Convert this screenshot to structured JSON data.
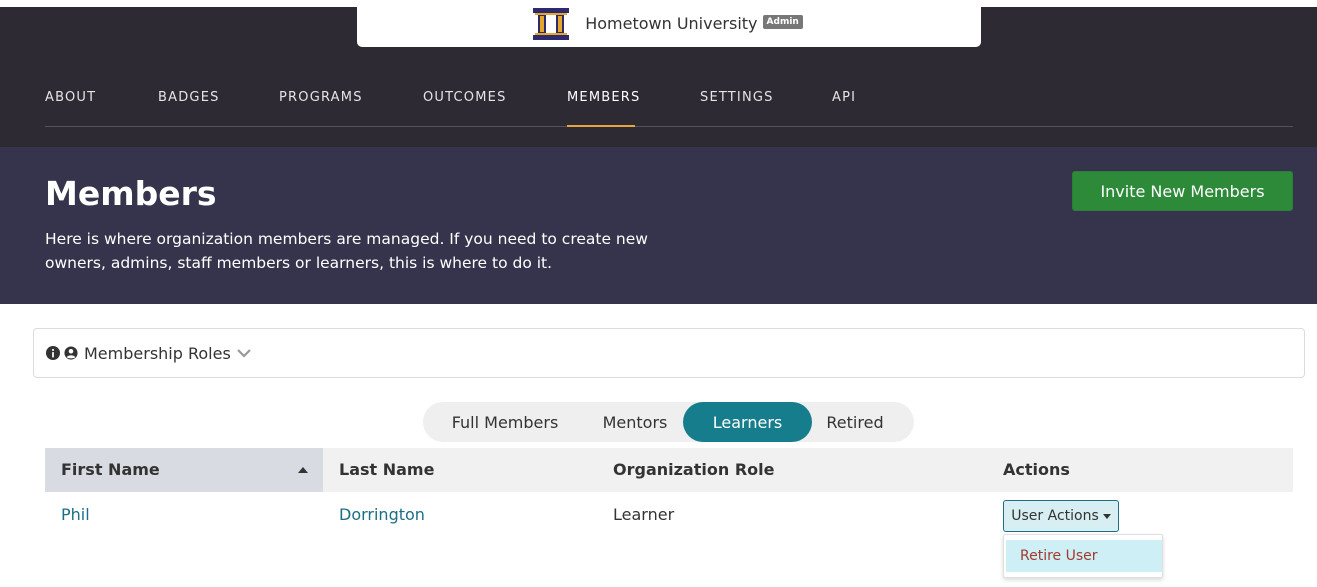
{
  "org": {
    "name": "Hometown University",
    "badge": "Admin",
    "logo_icon": "pillar-building-icon"
  },
  "nav": {
    "items": [
      "ABOUT",
      "BADGES",
      "PROGRAMS",
      "OUTCOMES",
      "MEMBERS",
      "SETTINGS",
      "API"
    ],
    "active": "MEMBERS",
    "accent": "#e8a33d"
  },
  "header": {
    "title": "Members",
    "description": "Here is where organization members are managed. If you need to create new owners, admins, staff members or learners, this is where to do it.",
    "invite_label": "Invite New Members"
  },
  "roles": {
    "label": "Membership Roles",
    "icons": [
      "info-circle-icon",
      "user-circle-icon",
      "chevron-down-icon"
    ]
  },
  "tabs": {
    "items": [
      "Full Members",
      "Mentors",
      "Learners",
      "Retired"
    ],
    "active": "Learners"
  },
  "table": {
    "columns": [
      "First Name",
      "Last Name",
      "Organization Role",
      "Actions"
    ],
    "sorted_column": "First Name",
    "sort_direction": "ascending",
    "rows": [
      {
        "first_name": "Phil",
        "last_name": "Dorrington",
        "role": "Learner",
        "action_label": "User Actions"
      }
    ]
  },
  "dropdown": {
    "items": [
      "Retire User"
    ]
  },
  "colors": {
    "nav_bg": "#2d2a33",
    "header_bg": "#36344c",
    "primary_btn": "#2d8a38",
    "tab_active": "#167d8c",
    "link": "#1c6e85",
    "danger_text": "#a23a2e"
  }
}
